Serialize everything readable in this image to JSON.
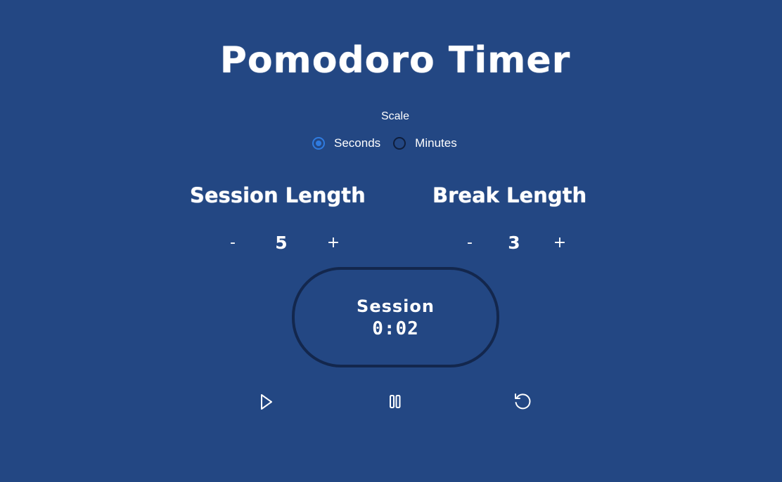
{
  "title": "Pomodoro Timer",
  "scale": {
    "label": "Scale",
    "options": [
      {
        "label": "Seconds",
        "checked": true
      },
      {
        "label": "Minutes",
        "checked": false
      }
    ]
  },
  "session": {
    "heading": "Session Length",
    "decrement": "-",
    "value": "5",
    "increment": "+"
  },
  "break": {
    "heading": "Break Length",
    "decrement": "-",
    "value": "3",
    "increment": "+"
  },
  "timer": {
    "label": "Session",
    "time": "0:02"
  },
  "controls": {
    "play_icon": "play-icon",
    "pause_icon": "pause-icon",
    "reset_icon": "reset-icon"
  },
  "colors": {
    "background": "#234783",
    "accent": "#2f7be0",
    "border": "#13274d"
  }
}
